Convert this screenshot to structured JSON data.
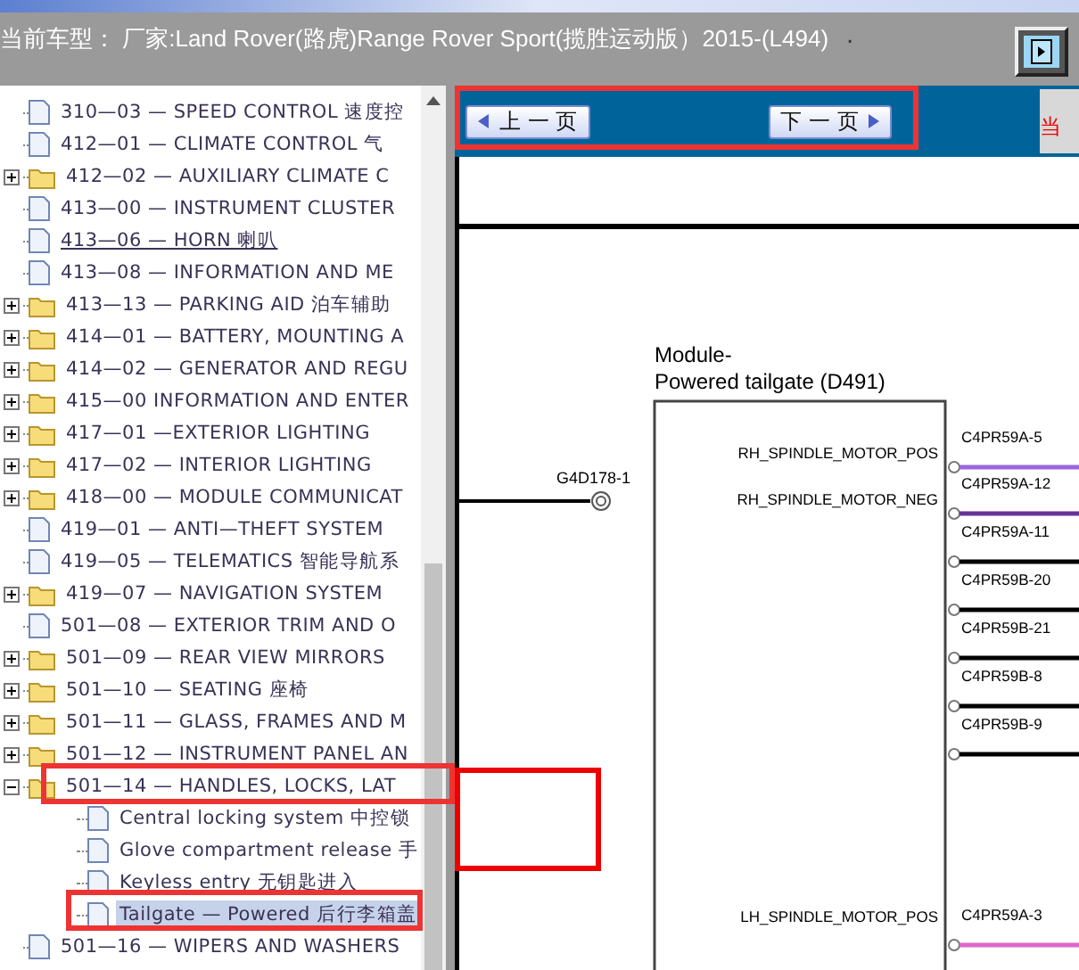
{
  "header": {
    "title": "当前车型： 厂家:Land Rover(路虎)Range Rover Sport(揽胜运动版）2015-(L494)",
    "mark": "."
  },
  "tree": [
    {
      "label": "310—03 — SPEED CONTROL 速度控",
      "kind": "doc",
      "hovered": false,
      "selected": false
    },
    {
      "label": "412—01 — CLIMATE CONTROL 气",
      "kind": "doc",
      "hovered": false,
      "selected": false
    },
    {
      "label": "412—02 — AUXILIARY CLIMATE C",
      "kind": "folder",
      "expanded": false,
      "hovered": false,
      "selected": false
    },
    {
      "label": "413—00 — INSTRUMENT CLUSTER",
      "kind": "doc",
      "hovered": false,
      "selected": false
    },
    {
      "label": "413—06 — HORN 喇叭",
      "kind": "doc",
      "hovered": true,
      "selected": false
    },
    {
      "label": "413—08 — INFORMATION AND ME",
      "kind": "doc",
      "hovered": false,
      "selected": false
    },
    {
      "label": "413—13 — PARKING AID 泊车辅助",
      "kind": "folder",
      "expanded": false,
      "hovered": false,
      "selected": false
    },
    {
      "label": "414—01 — BATTERY, MOUNTING A",
      "kind": "folder",
      "expanded": false,
      "hovered": false,
      "selected": false
    },
    {
      "label": "414—02 — GENERATOR AND REGU",
      "kind": "folder",
      "expanded": false,
      "hovered": false,
      "selected": false
    },
    {
      "label": "415—00 INFORMATION AND ENTER",
      "kind": "folder",
      "expanded": false,
      "hovered": false,
      "selected": false
    },
    {
      "label": "417—01 —EXTERIOR LIGHTING",
      "kind": "folder",
      "expanded": false,
      "hovered": false,
      "selected": false
    },
    {
      "label": "417—02 — INTERIOR LIGHTING",
      "kind": "folder",
      "expanded": false,
      "hovered": false,
      "selected": false
    },
    {
      "label": "418—00 — MODULE COMMUNICAT",
      "kind": "folder",
      "expanded": false,
      "hovered": false,
      "selected": false
    },
    {
      "label": "419—01 — ANTI—THEFT SYSTEM",
      "kind": "doc",
      "hovered": false,
      "selected": false
    },
    {
      "label": "419—05 — TELEMATICS 智能导航系",
      "kind": "doc",
      "hovered": false,
      "selected": false
    },
    {
      "label": "419—07 — NAVIGATION SYSTEM",
      "kind": "folder",
      "expanded": false,
      "hovered": false,
      "selected": false
    },
    {
      "label": "501—08 — EXTERIOR TRIM AND O",
      "kind": "doc",
      "hovered": false,
      "selected": false
    },
    {
      "label": "501—09 — REAR VIEW MIRRORS",
      "kind": "folder",
      "expanded": false,
      "hovered": false,
      "selected": false
    },
    {
      "label": "501—10 — SEATING 座椅",
      "kind": "folder",
      "expanded": false,
      "hovered": false,
      "selected": false
    },
    {
      "label": "501—11 — GLASS, FRAMES AND M",
      "kind": "folder",
      "expanded": false,
      "hovered": false,
      "selected": false
    },
    {
      "label": "501—12 — INSTRUMENT PANEL AN",
      "kind": "folder",
      "expanded": false,
      "hovered": false,
      "selected": false
    },
    {
      "label": "501—14 — HANDLES, LOCKS, LAT",
      "kind": "folder",
      "expanded": true,
      "hovered": false,
      "selected": false,
      "children": [
        {
          "label": "Central locking system 中控锁",
          "kind": "doc",
          "hovered": false,
          "selected": false
        },
        {
          "label": "Glove compartment release 手",
          "kind": "doc",
          "hovered": false,
          "selected": false
        },
        {
          "label": "Keyless entry 无钥匙进入",
          "kind": "doc",
          "hovered": false,
          "selected": false
        },
        {
          "label": "Tailgate — Powered 后行李箱盖",
          "kind": "doc",
          "hovered": false,
          "selected": true
        }
      ]
    },
    {
      "label": "501—16 — WIPERS AND WASHERS",
      "kind": "doc",
      "hovered": false,
      "selected": false
    }
  ],
  "nav": {
    "prev": "上 一 页",
    "next": "下 一 页",
    "current": "当"
  },
  "diagram": {
    "module_label": [
      "Module-",
      "Powered tailgate (D491)"
    ],
    "ground": "G4D178-1",
    "pins": [
      "RH_SPINDLE_MOTOR_POS",
      "RH_SPINDLE_MOTOR_NEG",
      "LH_SPINDLE_MOTOR_POS"
    ],
    "connectors": [
      {
        "label": "C4PR59A-5",
        "color": "#9966dd"
      },
      {
        "label": "C4PR59A-12",
        "color": "#663399"
      },
      {
        "label": "C4PR59A-11",
        "color": "#000000"
      },
      {
        "label": "C4PR59B-20",
        "color": "#000000"
      },
      {
        "label": "C4PR59B-21",
        "color": "#000000"
      },
      {
        "label": "C4PR59B-8",
        "color": "#000000"
      },
      {
        "label": "C4PR59B-9",
        "color": "#000000"
      },
      {
        "label": "C4PR59A-3",
        "color": "#dd66cc"
      }
    ]
  }
}
